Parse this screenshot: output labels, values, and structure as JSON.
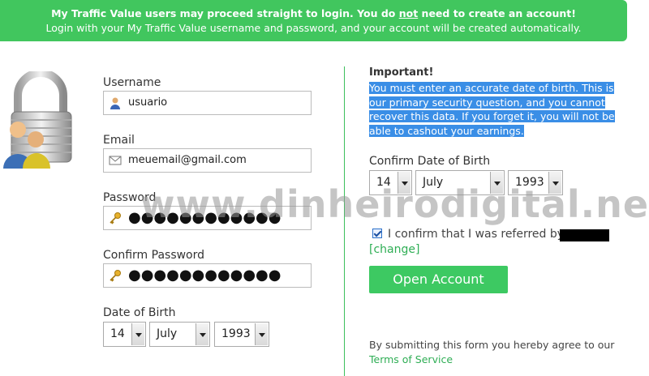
{
  "banner": {
    "line1_pre": "My Traffic Value users may proceed straight to login. You do ",
    "line1_emph": "not",
    "line1_post": " need to create an account!",
    "line2": "Login with your My Traffic Value username and password, and your account will be created automatically."
  },
  "form": {
    "username_label": "Username",
    "username_value": "usuario",
    "email_label": "Email",
    "email_value": "meuemail@gmail.com",
    "password_label": "Password",
    "password_value": "●●●●●●●●●●●●",
    "confirm_password_label": "Confirm Password",
    "confirm_password_value": "●●●●●●●●●●●●",
    "dob_label": "Date of Birth",
    "dob_day": "14",
    "dob_month": "July",
    "dob_year": "1993"
  },
  "right": {
    "important_title": "Important!",
    "important_text": "You must enter an accurate date of birth. This is our primary security question, and you cannot recover this data. If you forget it, you will not be able to cashout your earnings.",
    "confirm_dob_label": "Confirm Date of Birth",
    "confirm_dob_day": "14",
    "confirm_dob_month": "July",
    "confirm_dob_year": "1993",
    "referral_text": "I confirm that I was referred by",
    "change_link": "[change]",
    "open_account_button": "Open Account",
    "agree_text": "By submitting this form you hereby agree to our",
    "tos_link": "Terms of Service"
  },
  "watermark": "www.dinheirodigital.net",
  "icons": {
    "lock": "padlock-users-icon",
    "username": "user-icon",
    "email": "envelope-icon",
    "password": "key-icon",
    "confirm_password": "key-icon"
  },
  "colors": {
    "banner": "#41c65e",
    "accent": "#3dc962",
    "link": "#2fae55",
    "selection": "#3a8ee6"
  }
}
